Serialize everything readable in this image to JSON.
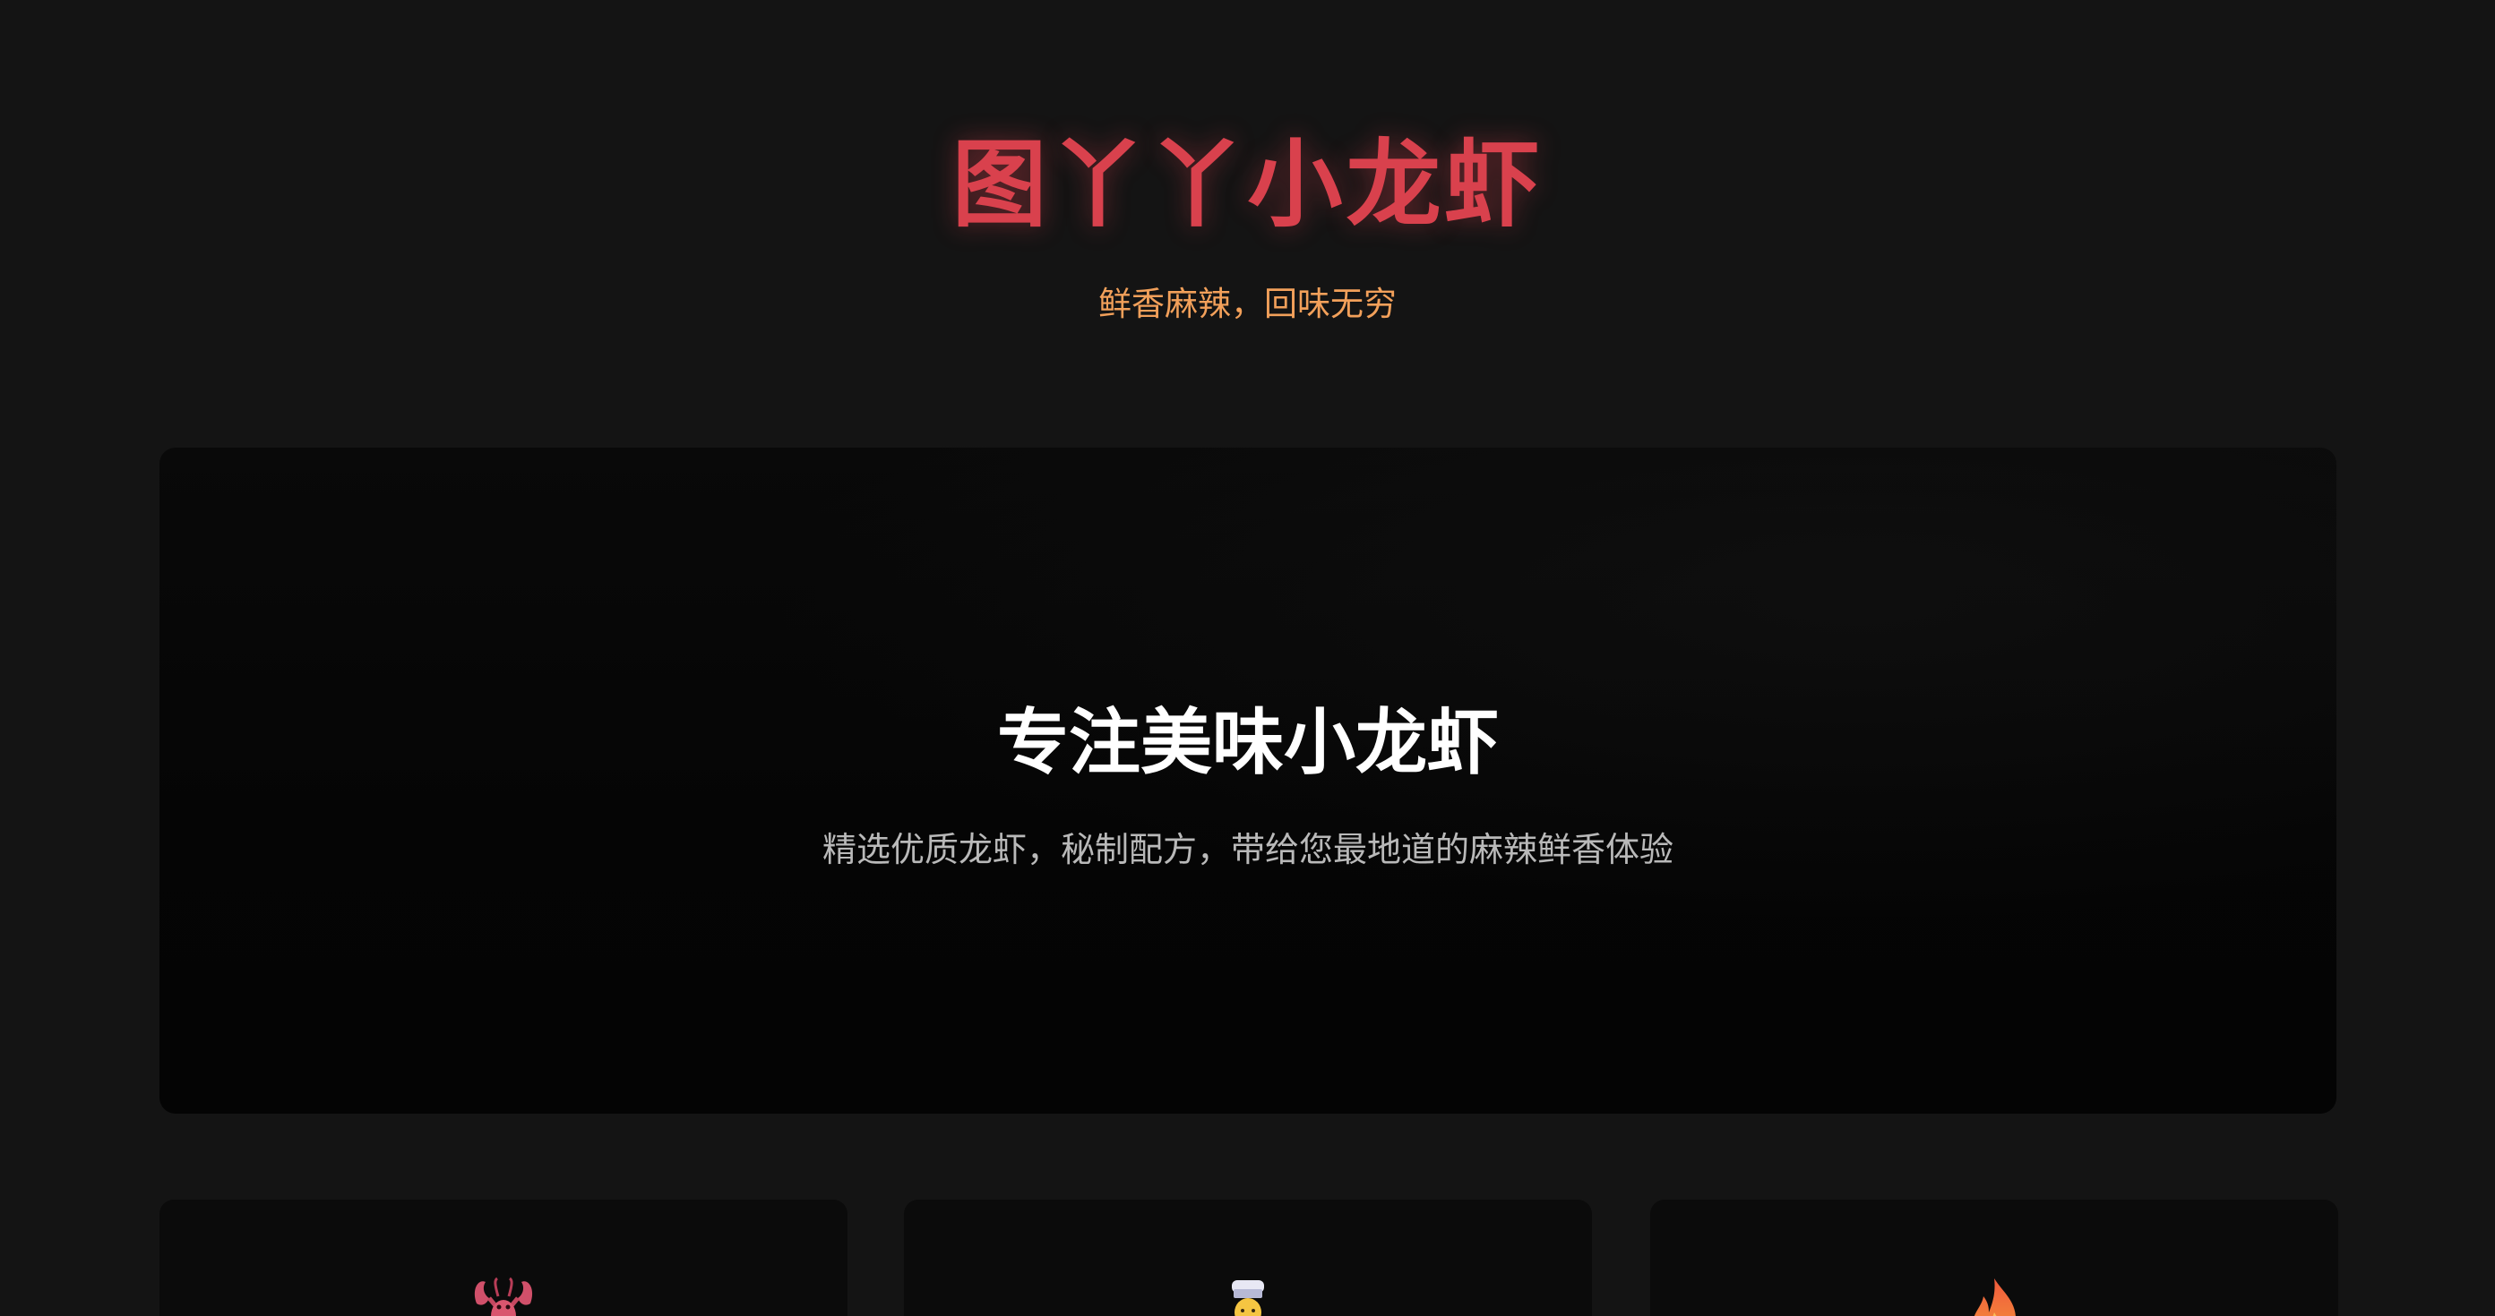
{
  "header": {
    "title": "图丫丫小龙虾",
    "tagline": "鲜香麻辣，回味无穷"
  },
  "hero": {
    "heading": "专注美味小龙虾",
    "subheading": "精选优质龙虾，秘制配方，带给您最地道的麻辣鲜香体验"
  },
  "features": [
    {
      "icon": "lobster-icon"
    },
    {
      "icon": "chef-icon"
    },
    {
      "icon": "fire-icon"
    }
  ],
  "colors": {
    "background": "#141414",
    "title": "#d9414d",
    "tagline": "#f2a05a",
    "hero_heading": "#ffffff",
    "hero_sub": "#b9b9b9"
  }
}
